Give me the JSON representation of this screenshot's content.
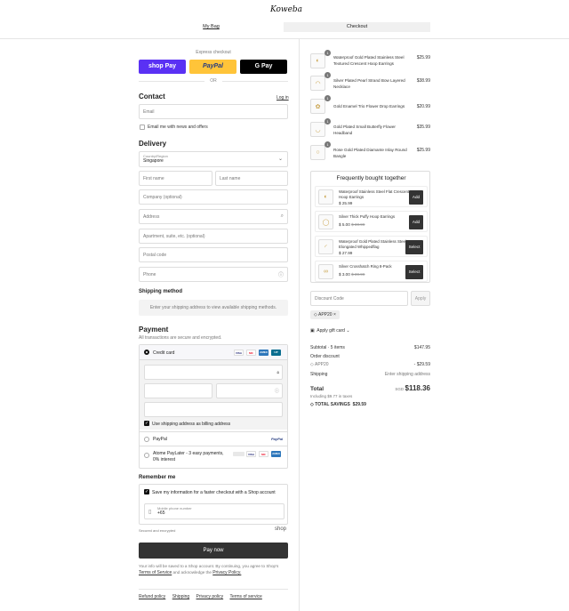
{
  "header": {
    "logo": "Koweba",
    "tab_bag": "My Bag",
    "tab_checkout": "Checkout"
  },
  "express": {
    "label": "Express checkout",
    "shoppay": "shop Pay",
    "paypal": "PayPal",
    "gpay": "G Pay",
    "or": "OR"
  },
  "contact": {
    "title": "Contact",
    "login": "Log in",
    "email_placeholder": "Email",
    "newsletter": "Email me with news and offers"
  },
  "delivery": {
    "title": "Delivery",
    "country_label": "Country/Region",
    "country_value": "Singapore",
    "first_name": "First name",
    "last_name": "Last name",
    "company": "Company (optional)",
    "address": "Address",
    "apartment": "Apartment, suite, etc. (optional)",
    "postal": "Postal code",
    "phone": "Phone"
  },
  "shipping_method": {
    "title": "Shipping method",
    "note": "Enter your shipping address to view available shipping methods."
  },
  "payment": {
    "title": "Payment",
    "subtitle": "All transactions are secure and encrypted.",
    "credit_card": "Credit card",
    "use_shipping": "Use shipping address as billing address",
    "paypal": "PayPal",
    "atome": "Atome PayLater - 3 easy payments, 0% interest",
    "card_brands": [
      "VISA",
      "MC",
      "AMEX",
      "UP"
    ]
  },
  "remember": {
    "title": "Remember me",
    "save_info": "Save my information for a faster checkout with a Shop account",
    "mobile_label": "Mobile phone number",
    "mobile_value": "+65",
    "secure": "Secured and encrypted",
    "shop": "shop"
  },
  "paynow": "Pay now",
  "legal": {
    "line1": "Your info will be saved to a Shop account. By continuing, you agree to Shop's",
    "terms": "Terms of Service",
    "and": "and acknowledge the",
    "privacy": "Privacy Policy."
  },
  "footer": {
    "links": [
      "Refund policy",
      "Shipping",
      "Privacy policy",
      "Terms of service"
    ]
  },
  "cart": {
    "items": [
      {
        "qty": "1",
        "name": "Waterproof Gold Plated Stainless Steel Textured Crescent Hoop Earrings",
        "price": "$25.99"
      },
      {
        "qty": "1",
        "name": "Silver Plated Pearl Strand Bow Layered Necklace",
        "price": "$38.99"
      },
      {
        "qty": "1",
        "name": "Gold Enamel Trio Flower Drop Earrings",
        "price": "$20.99"
      },
      {
        "qty": "1",
        "name": "Gold Plated Small Butterfly Flower Headband",
        "price": "$35.99"
      },
      {
        "qty": "1",
        "name": "Rose Gold Plated Diamante Inlay Round Bangle",
        "price": "$25.99"
      }
    ]
  },
  "fbt": {
    "title": "Frequently bought together",
    "items": [
      {
        "name": "Waterproof Stainless Steel Flat Crescent Hoop Earrings",
        "price": "$ 25.99",
        "old": "",
        "button": "Add"
      },
      {
        "name": "Silver Thick Puffy Hoop Earrings",
        "price": "$ 5.00",
        "old": "$ 30.99",
        "button": "Add"
      },
      {
        "name": "Waterproof Gold Plated Stainless Steel Elongated Whippedflag",
        "price": "$ 27.99",
        "old": "",
        "button": "Select"
      },
      {
        "name": "Silver Crosshatch Ring 8-Pack",
        "price": "$ 3.00",
        "old": "$ 39.99",
        "button": "Select"
      }
    ]
  },
  "discount": {
    "placeholder": "Discount Code",
    "apply": "Apply",
    "chip": "APP20"
  },
  "gift": "Apply gift card",
  "summary": {
    "subtotal_label": "Subtotal · 5 items",
    "subtotal": "$147.95",
    "order_discount": "Order discount",
    "discount_code": "APP20",
    "discount_value": "- $29.59",
    "shipping_label": "Shipping",
    "shipping_value": "Enter shipping address",
    "total_label": "Total",
    "currency": "SGD",
    "total": "$118.36",
    "taxes": "Including $9.77 in taxes",
    "savings_label": "TOTAL SAVINGS",
    "savings": "$29.59"
  }
}
